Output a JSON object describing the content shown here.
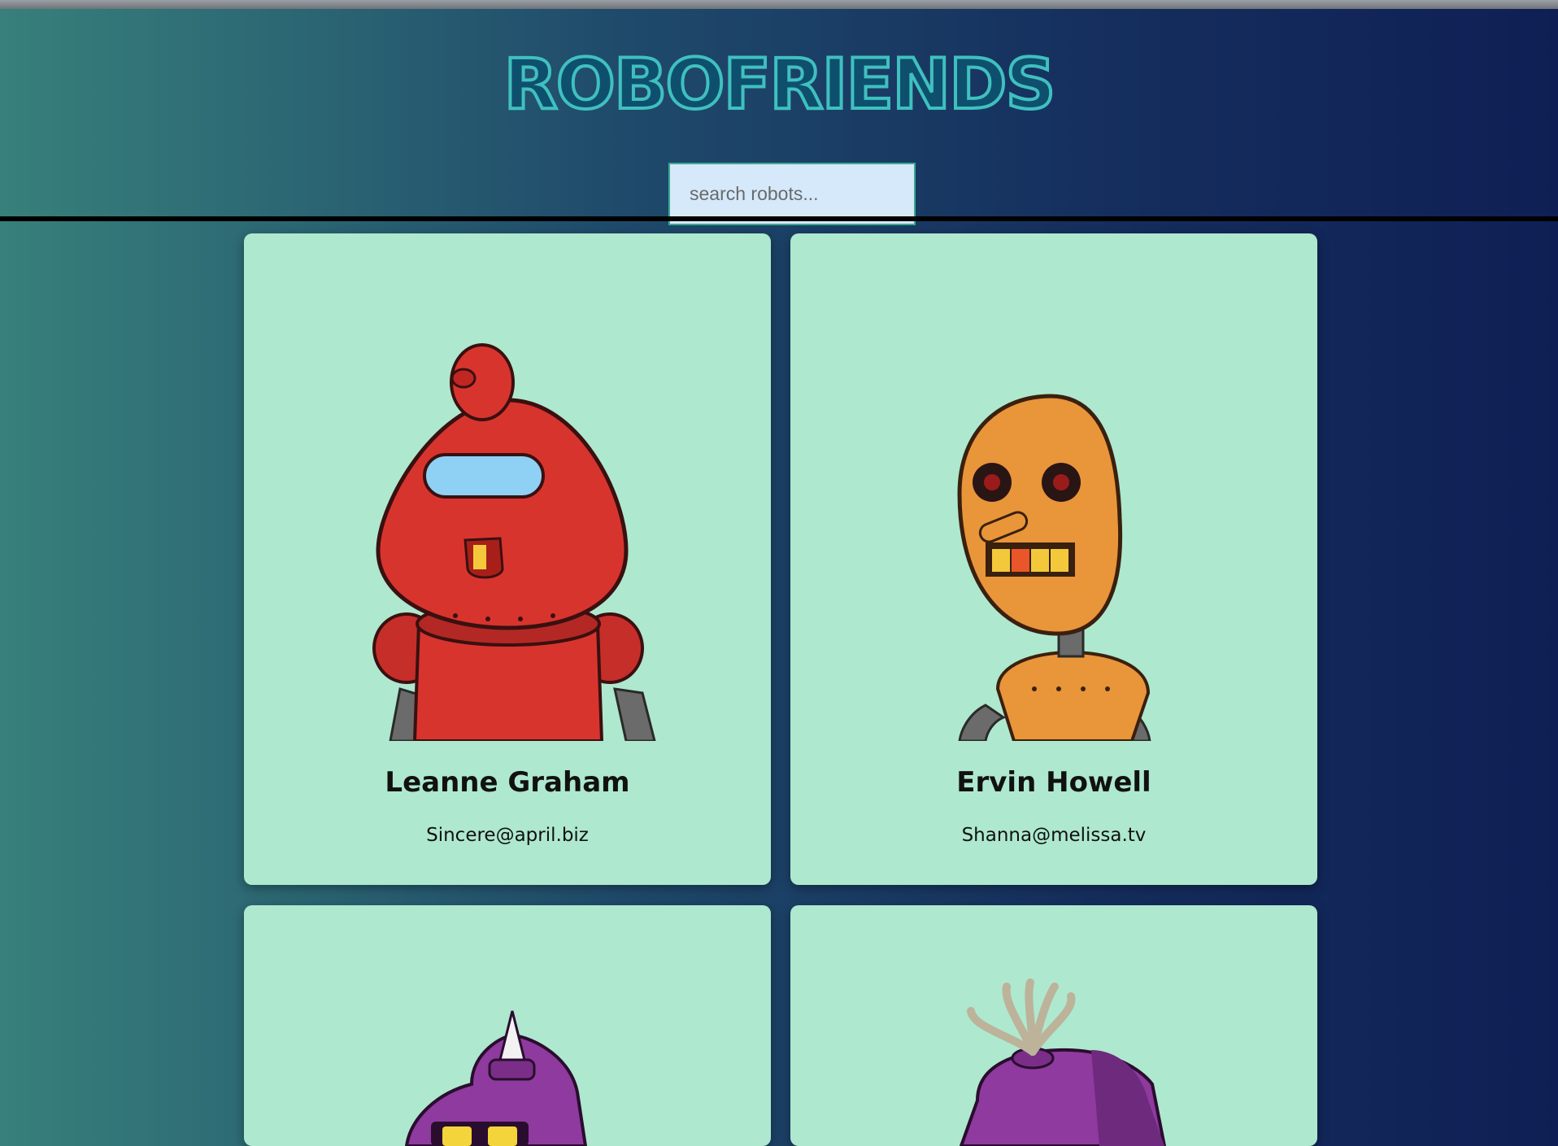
{
  "app": {
    "title": "ROBOFRIENDS"
  },
  "search": {
    "placeholder": "search robots...",
    "value": ""
  },
  "robots": [
    {
      "name": "Leanne Graham",
      "email": "Sincere@april.biz",
      "icon": "red-robot"
    },
    {
      "name": "Ervin Howell",
      "email": "Shanna@melissa.tv",
      "icon": "orange-robot"
    },
    {
      "icon": "purple-horned-robot"
    },
    {
      "icon": "purple-antenna-robot"
    }
  ],
  "colors": {
    "card_bg": "#aee8cf",
    "logo_outline": "#3fc0bf",
    "search_bg": "#d5e9fb"
  }
}
